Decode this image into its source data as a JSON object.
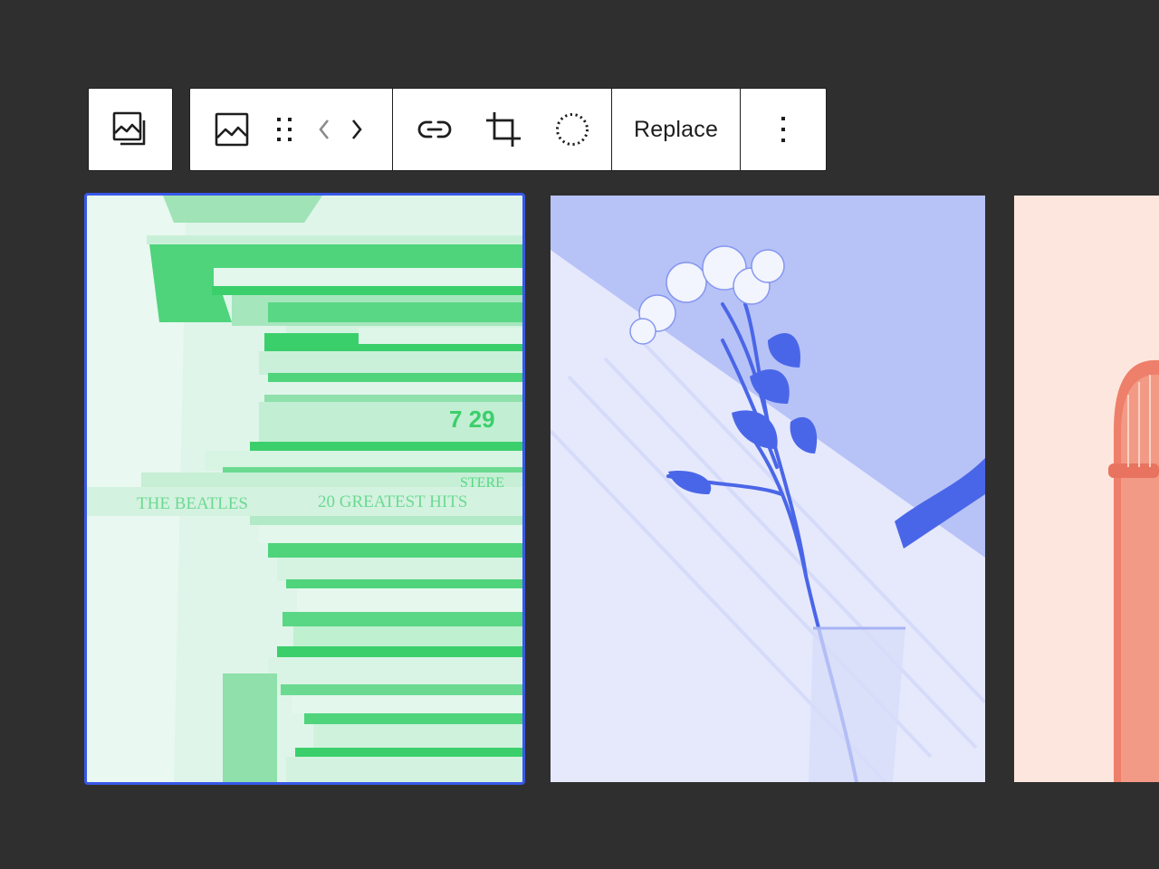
{
  "toolbar": {
    "parent_icon": "gallery-icon",
    "block_icon": "image-icon",
    "drag_icon": "drag-handle-icon",
    "move_left_icon": "chevron-left-icon",
    "move_right_icon": "chevron-right-icon",
    "link_icon": "link-icon",
    "crop_icon": "crop-icon",
    "duotone_icon": "circle-dotted-icon",
    "replace_label": "Replace",
    "options_icon": "more-vertical-icon"
  },
  "gallery": {
    "images": [
      {
        "duotone": [
          "#dff5ea",
          "#3bcf6b"
        ],
        "selected": true,
        "printed_text": [
          "7 29",
          "THE BEATLES",
          "20 GREATEST HITS",
          "STERE"
        ]
      },
      {
        "duotone": [
          "#eef0fd",
          "#4a66e8"
        ],
        "selected": false
      },
      {
        "duotone": [
          "#fde6dd",
          "#ee7f6a"
        ],
        "selected": false
      }
    ]
  },
  "colors": {
    "canvas_bg": "#2f2f2f",
    "toolbar_bg": "#ffffff",
    "toolbar_border": "#1e1e1e",
    "selection": "#3858e9"
  }
}
